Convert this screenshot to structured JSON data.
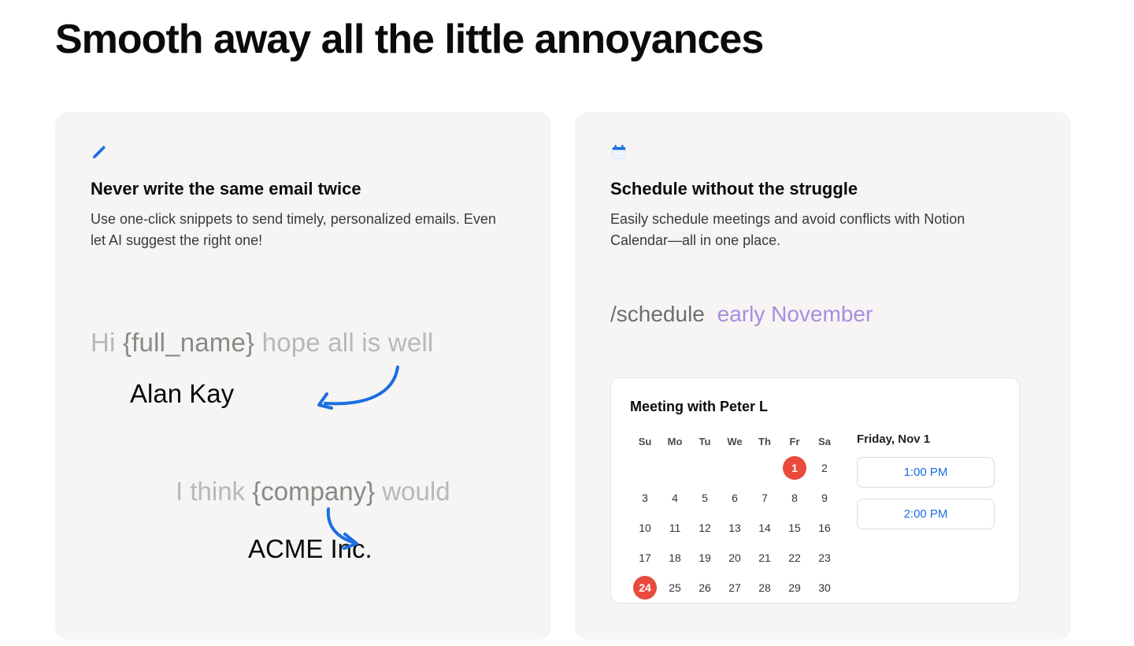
{
  "section": {
    "title": "Smooth away all the little annoyances"
  },
  "cards": {
    "snippets": {
      "title": "Never write the same email twice",
      "description": "Use one-click snippets to send timely, personalized emails. Even let AI suggest the right one!",
      "demo": {
        "line1_hi": "Hi ",
        "line1_placeholder": "{full_name}",
        "line1_rest": " hope all is well",
        "name_value": "Alan Kay",
        "line2_prefix": "I think ",
        "line2_placeholder": "{company}",
        "line2_rest": " would",
        "company_value": "ACME Inc."
      }
    },
    "schedule": {
      "title": "Schedule without the struggle",
      "description": "Easily schedule meetings and avoid conflicts with Notion Calendar—all in one place.",
      "command": "/schedule",
      "argument": "early November",
      "meeting_title": "Meeting with Peter L",
      "calendar": {
        "dow": [
          "Su",
          "Mo",
          "Tu",
          "We",
          "Th",
          "Fr",
          "Sa"
        ],
        "weeks": [
          [
            "",
            "",
            "",
            "",
            "",
            "1",
            "2"
          ],
          [
            "3",
            "4",
            "5",
            "6",
            "7",
            "8",
            "9"
          ],
          [
            "10",
            "11",
            "12",
            "13",
            "14",
            "15",
            "16"
          ],
          [
            "17",
            "18",
            "19",
            "20",
            "21",
            "22",
            "23"
          ],
          [
            "24",
            "25",
            "26",
            "27",
            "28",
            "29",
            "30"
          ]
        ],
        "selected": "1",
        "today": "24",
        "selected_date_label": "Friday, Nov 1",
        "times": [
          "1:00 PM",
          "2:00 PM"
        ]
      }
    }
  },
  "colors": {
    "accent_blue": "#1a6ee0",
    "accent_red": "#e84b3c",
    "accent_purple": "#a88ee0",
    "card_bg": "#f6f5f4"
  }
}
